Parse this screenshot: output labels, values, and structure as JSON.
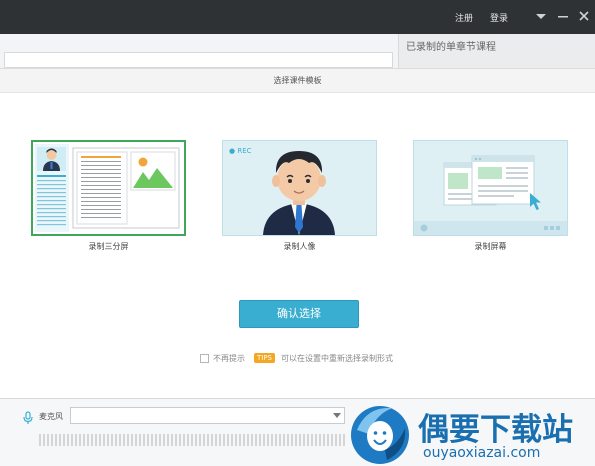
{
  "titlebar": {
    "register_label": "注册",
    "login_label": "登录"
  },
  "background": {
    "recorded_panel_title": "已录制的单章节课程"
  },
  "modal": {
    "title": "选择课件模板",
    "modes": [
      {
        "label": "录制三分屏",
        "selected": true,
        "icon": "split-screen-illustration"
      },
      {
        "label": "录制人像",
        "selected": false,
        "icon": "presenter-rec-illustration",
        "badge": "● REC"
      },
      {
        "label": "录制屏幕",
        "selected": false,
        "icon": "screen-record-illustration"
      }
    ],
    "confirm_label": "确认选择",
    "no_more_label": "不再提示",
    "tips_badge": "TIPS",
    "tips_text": "可以在设置中重新选择录制形式"
  },
  "bottom": {
    "mic_label": "麦克风",
    "mic_value": ""
  },
  "watermark": {
    "name": "偶要下载站",
    "url": "ouyaoxiazai.com"
  },
  "colors": {
    "titlebar_bg": "#2f3235",
    "accent_blue": "#3aaed0",
    "selected_green": "#3fa65a",
    "tips_orange": "#f5a623",
    "watermark_blue": "#1a6fb0"
  }
}
